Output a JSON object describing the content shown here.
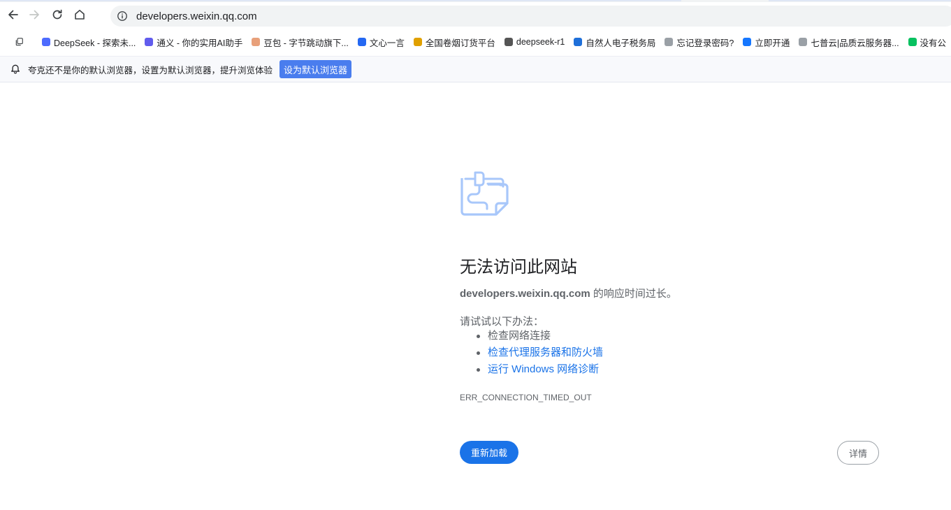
{
  "browser": {
    "address_bar": {
      "url": "developers.weixin.qq.com"
    },
    "bookmarks": [
      {
        "label": "DeepSeek - 探索未...",
        "icon": "whale-icon",
        "color": "#4d6bfe"
      },
      {
        "label": "通义 - 你的实用AI助手",
        "icon": "tongyi-icon",
        "color": "#615ced"
      },
      {
        "label": "豆包 - 字节跳动旗下...",
        "icon": "doubao-icon",
        "color": "#e8a07a"
      },
      {
        "label": "文心一言",
        "icon": "wenxin-icon",
        "color": "#2468f2"
      },
      {
        "label": "全国卷烟订货平台",
        "icon": "c-icon",
        "color": "#e0a000"
      },
      {
        "label": "deepseek-r1",
        "icon": "robot-icon",
        "color": "#555555"
      },
      {
        "label": "自然人电子税务局",
        "icon": "tax-icon",
        "color": "#1e6fd9"
      },
      {
        "label": "忘记登录密码?",
        "icon": "globe-icon",
        "color": "#9aa0a6"
      },
      {
        "label": "立即开通",
        "icon": "alipay-icon",
        "color": "#1677ff"
      },
      {
        "label": "七普云|品质云服务器...",
        "icon": "globe-icon",
        "color": "#9aa0a6"
      },
      {
        "label": "没有公",
        "icon": "wechat-icon",
        "color": "#07c160"
      }
    ],
    "infobar": {
      "message": "夸克还不是你的默认浏览器，设置为默认浏览器，提升浏览体验",
      "button": "设为默认浏览器"
    }
  },
  "error_page": {
    "title": "无法访问此网站",
    "host": "developers.weixin.qq.com",
    "desc_suffix": " 的响应时间过长。",
    "suggestions_heading": "请试试以下办法：",
    "suggestions": [
      {
        "text": "检查网络连接",
        "link": false
      },
      {
        "text": "检查代理服务器和防火墙",
        "link": true
      },
      {
        "text": "运行 Windows 网络诊断",
        "link": true
      }
    ],
    "error_code": "ERR_CONNECTION_TIMED_OUT",
    "reload_button": "重新加载",
    "details_button": "详情"
  }
}
